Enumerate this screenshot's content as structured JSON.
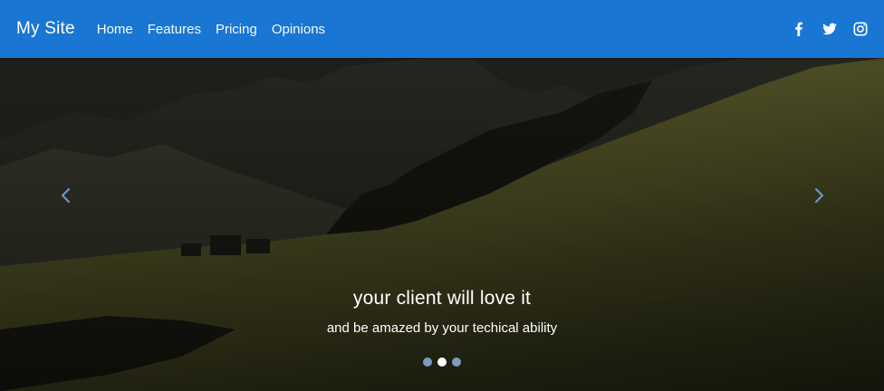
{
  "navbar": {
    "brand": "My Site",
    "links": [
      "Home",
      "Features",
      "Pricing",
      "Opinions"
    ],
    "social": [
      "facebook-icon",
      "twitter-icon",
      "instagram-icon"
    ],
    "color": "#1976d2"
  },
  "carousel": {
    "caption_title": "your client will love it",
    "caption_subtitle": "and be amazed by your techical ability",
    "slide_count": 3,
    "active_slide": 2,
    "prev_icon": "chevron-left-icon",
    "next_icon": "chevron-right-icon"
  }
}
